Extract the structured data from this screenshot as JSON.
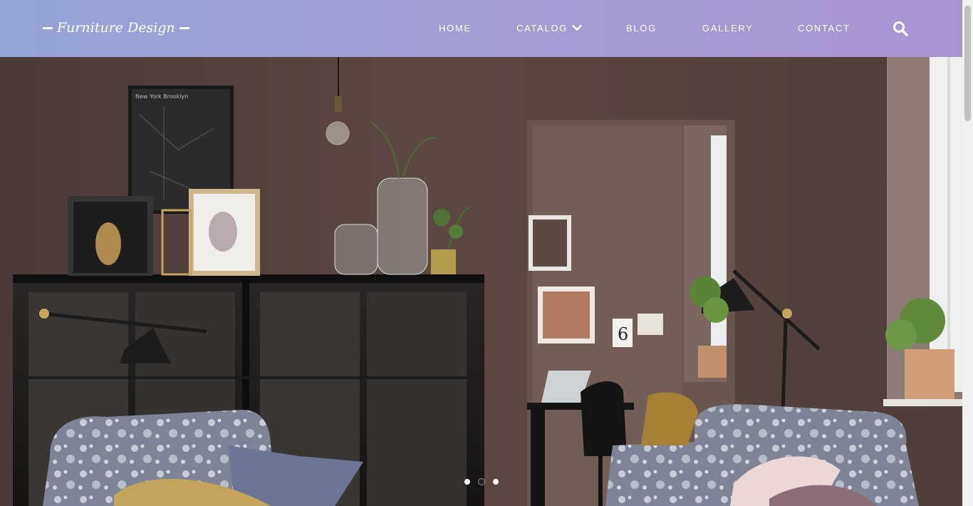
{
  "logo": {
    "text": "Furniture Design"
  },
  "nav": {
    "items": [
      {
        "label": "HOME"
      },
      {
        "label": "CATALOG",
        "has_dropdown": true
      },
      {
        "label": "BLOG"
      },
      {
        "label": "GALLERY"
      },
      {
        "label": "CONTACT"
      }
    ],
    "search_icon": "search-icon",
    "dropdown_icon": "chevron-down-icon"
  },
  "hero": {
    "image": "living-room-photo",
    "poster_text": "New York Brooklyn",
    "number_card": "6"
  },
  "slider": {
    "dots": 3,
    "active_index": 1
  },
  "colors": {
    "header_gradient_start": "#95a3d6",
    "header_gradient_end": "#a994d1",
    "wall": "#5b4642"
  }
}
